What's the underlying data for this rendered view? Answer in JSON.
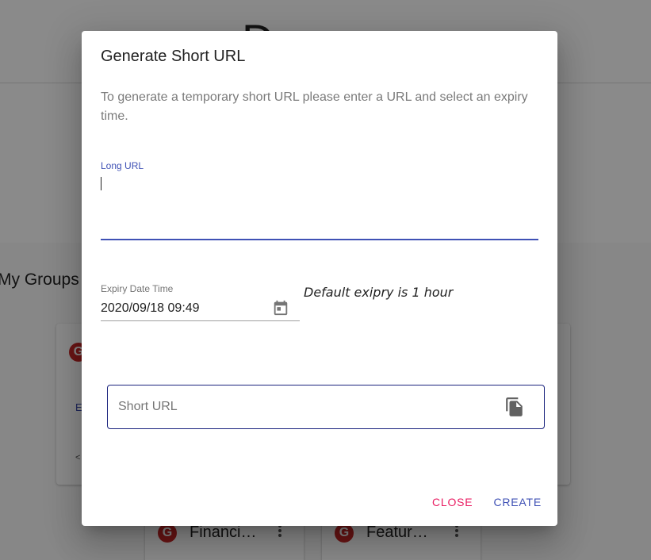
{
  "background": {
    "title": "D",
    "section_title": "My Groups",
    "card_avatar_letter": "G",
    "card_link_text": "E",
    "small_cards": [
      {
        "avatar": "G",
        "label": "Financi…"
      },
      {
        "avatar": "G",
        "label": "Featur…"
      }
    ]
  },
  "dialog": {
    "title": "Generate Short URL",
    "description": "To generate a temporary short URL please enter a URL and select an expiry time.",
    "long_url": {
      "label": "Long URL",
      "value": ""
    },
    "expiry": {
      "label": "Expiry Date Time",
      "value": "2020/09/18 09:49",
      "icon": "calendar-icon",
      "hint": "Default exipry is 1 hour"
    },
    "short_url": {
      "placeholder": "Short URL",
      "value": "",
      "icon": "copy-icon"
    },
    "actions": {
      "close_label": "CLOSE",
      "create_label": "CREATE"
    }
  },
  "colors": {
    "primary": "#3f51b5",
    "accent": "#e91e63",
    "scrim": "rgba(0,0,0,0.46)"
  }
}
